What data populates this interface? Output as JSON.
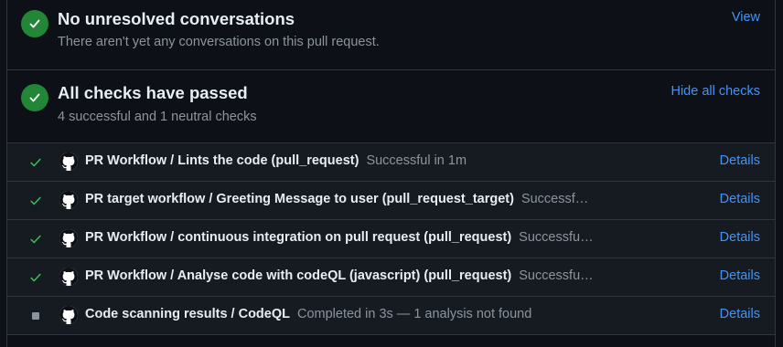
{
  "conversations": {
    "title": "No unresolved conversations",
    "subtitle": "There aren't yet any conversations on this pull request.",
    "link": "View",
    "status_color": "#238636"
  },
  "checks": {
    "title": "All checks have passed",
    "subtitle": "4 successful and 1 neutral checks",
    "link": "Hide all checks",
    "status_color": "#238636",
    "rows": [
      {
        "status": "success",
        "icon": "github-icon",
        "name": "PR Workflow / Lints the code (pull_request)",
        "desc": "Successful in 1m",
        "details": "Details"
      },
      {
        "status": "success",
        "icon": "github-icon",
        "name": "PR target workflow / Greeting Message to user (pull_request_target)",
        "desc": "Successf…",
        "details": "Details"
      },
      {
        "status": "success",
        "icon": "github-icon",
        "name": "PR Workflow / continuous integration on pull request (pull_request)",
        "desc": "Successfu…",
        "details": "Details"
      },
      {
        "status": "success",
        "icon": "github-icon",
        "name": "PR Workflow / Analyse code with codeQL (javascript) (pull_request)",
        "desc": "Successfu…",
        "details": "Details"
      },
      {
        "status": "neutral",
        "icon": "github-icon",
        "name": "Code scanning results / CodeQL",
        "desc": "Completed in 3s — 1 analysis not found",
        "details": "Details"
      }
    ]
  },
  "colors": {
    "accent_link": "#4493f8",
    "success": "#3fb950",
    "neutral": "#8b949e",
    "background": "#0d1117",
    "row_background": "#161b22"
  }
}
